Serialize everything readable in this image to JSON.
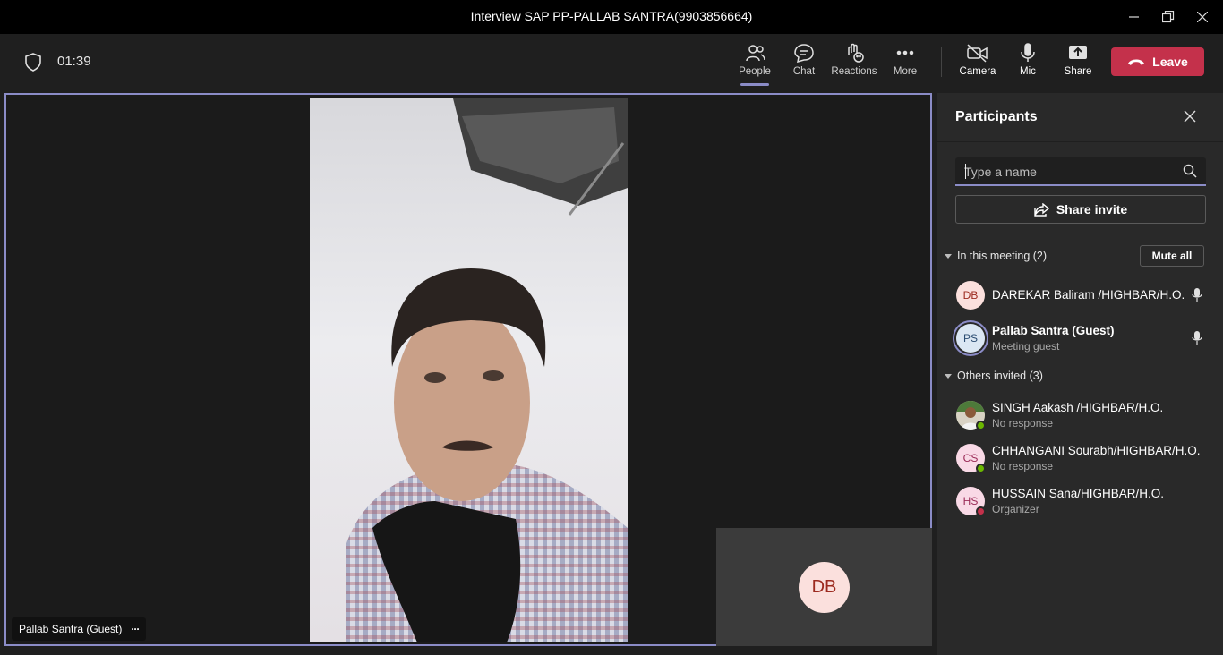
{
  "window": {
    "title": "Interview SAP PP-PALLAB SANTRA(9903856664)"
  },
  "toolbar": {
    "timer": "01:39",
    "people_label": "People",
    "chat_label": "Chat",
    "reactions_label": "Reactions",
    "more_label": "More",
    "camera_label": "Camera",
    "mic_label": "Mic",
    "share_label": "Share",
    "leave_label": "Leave",
    "accent_color": "#8b8cc7",
    "leave_color": "#c4314b"
  },
  "stage": {
    "main_name_tag": "Pallab Santra (Guest)",
    "name_tag_more": "···",
    "pip_initials": "DB"
  },
  "panel": {
    "title": "Participants",
    "search_placeholder": "Type a name",
    "share_invite_label": "Share invite",
    "in_meeting_label": "In this meeting (2)",
    "mute_all_label": "Mute all",
    "others_label": "Others invited (3)",
    "in_meeting": [
      {
        "initials": "DB",
        "name": "DAREKAR Baliram /HIGHBAR/H.O.",
        "sub": ""
      },
      {
        "initials": "PS",
        "name": "Pallab Santra (Guest)",
        "sub": "Meeting guest"
      }
    ],
    "others": [
      {
        "initials": "",
        "name": "SINGH Aakash /HIGHBAR/H.O.",
        "sub": "No response",
        "status": "available"
      },
      {
        "initials": "CS",
        "name": "CHHANGANI Sourabh/HIGHBAR/H.O.",
        "sub": "No response",
        "status": "available"
      },
      {
        "initials": "HS",
        "name": "HUSSAIN Sana/HIGHBAR/H.O.",
        "sub": "Organizer",
        "status": "busy"
      }
    ]
  }
}
